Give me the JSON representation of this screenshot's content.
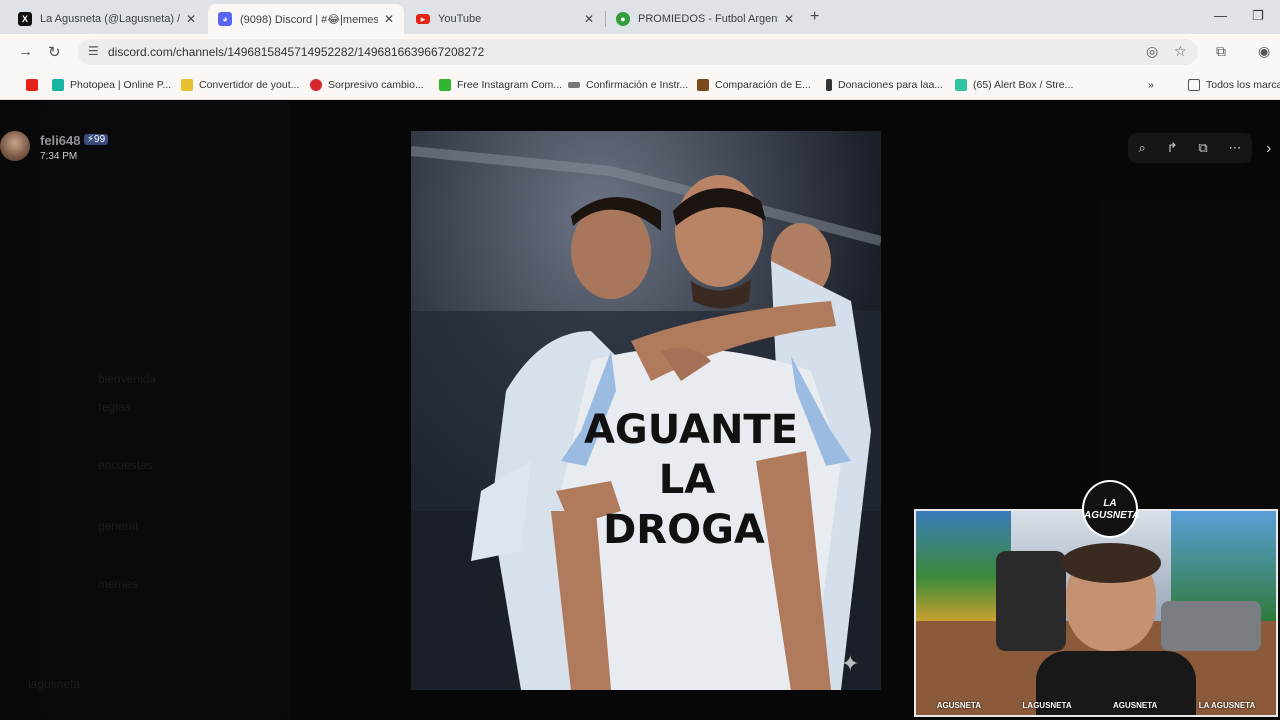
{
  "browser": {
    "tabs": [
      {
        "title": "La Agusneta (@Lagusneta) / X",
        "icon": "x-logo-icon",
        "active": false
      },
      {
        "title": "(9098) Discord | #😂|memes | ...",
        "icon": "discord-icon",
        "active": true
      },
      {
        "title": "YouTube",
        "icon": "youtube-icon",
        "active": false
      },
      {
        "title": "PROMIEDOS - Futbol Argentino",
        "icon": "promiedos-icon",
        "active": false
      }
    ],
    "url": "discord.com/channels/1496815845714952282/1496816639667208272",
    "bookmarks": [
      {
        "label": "",
        "icon": "youtube-icon",
        "color": "#e62117"
      },
      {
        "label": "Photopea | Online P...",
        "icon": "photopea-icon",
        "color": "#19b3a4"
      },
      {
        "label": "Convertidor de yout...",
        "icon": "converter-icon",
        "color": "#e8c02f"
      },
      {
        "label": "Sorpresivo cambio...",
        "icon": "news-icon",
        "color": "#d6252d"
      },
      {
        "label": "Free Instagram Com...",
        "icon": "instagram-comment-icon",
        "color": "#2fb52f"
      },
      {
        "label": "Confirmación e Instr...",
        "icon": "link-icon",
        "color": "#555555"
      },
      {
        "label": "Comparación de E...",
        "icon": "comparison-icon",
        "color": "#7a4a1a"
      },
      {
        "label": "Donaciones para laa...",
        "icon": "donation-icon",
        "color": "#333333"
      },
      {
        "label": "(65) Alert Box / Stre...",
        "icon": "streamlabs-icon",
        "color": "#31c3a2"
      }
    ],
    "all_bookmarks": "Todos los marca"
  },
  "viewer": {
    "username": "feli648",
    "badge": "⚡99",
    "time": "7:34 PM"
  },
  "image": {
    "shirt_text": [
      "AGUANTE",
      "LA",
      "DROGA"
    ]
  },
  "webcam": {
    "logo": "LA AGUSNETA",
    "socials": [
      "AGUSNETA",
      "LAGUSNETA",
      "AGUSNETA",
      "LA AGUSNETA"
    ]
  },
  "background": {
    "channels": [
      "bienvenida",
      "reglas",
      "encuestas",
      "general",
      "memes"
    ],
    "user": "lagusneta"
  }
}
